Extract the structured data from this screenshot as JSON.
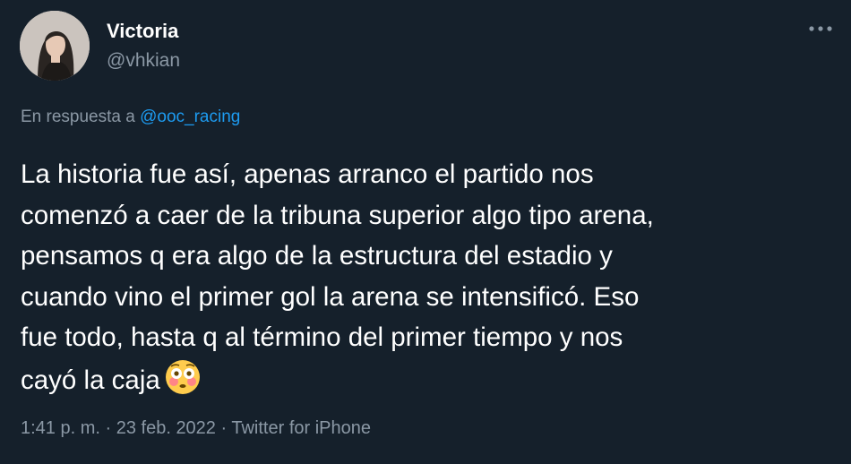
{
  "author": {
    "display_name": "Victoria",
    "username": "@vhkian",
    "avatar_icon": "profile-photo"
  },
  "menu": {
    "icon": "more-horizontal-icon"
  },
  "reply": {
    "prefix": "En respuesta a ",
    "handle": "@ooc_racing"
  },
  "tweet": {
    "lines": [
      "La historia fue así, apenas arranco el partido nos",
      "comenzó a caer de la tribuna superior algo tipo arena,",
      "pensamos q era algo de la estructura del estadio y",
      "cuando vino el primer gol la arena se intensificó. Eso",
      "fue todo, hasta q al término del primer tiempo y nos",
      "cayó la caja"
    ],
    "emoji": "flushed-face-emoji"
  },
  "meta": {
    "time": "1:41 p. m.",
    "date": "23 feb. 2022",
    "source": "Twitter for iPhone",
    "separator": " · "
  },
  "colors": {
    "background": "#15202b",
    "primary_text": "#ffffff",
    "secondary_text": "#8b98a5",
    "link": "#1d9bf0"
  }
}
